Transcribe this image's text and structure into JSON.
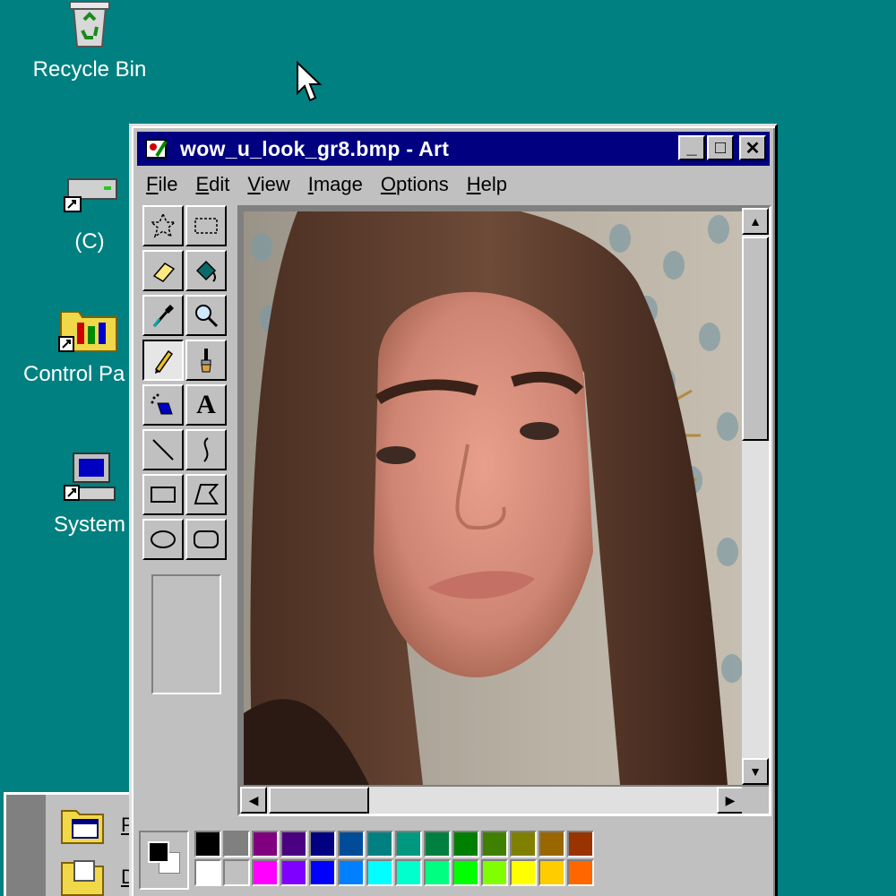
{
  "desktop": {
    "icons": [
      {
        "label": "Recycle Bin"
      },
      {
        "label": "(C)"
      },
      {
        "label": "Control Pa"
      },
      {
        "label": "System"
      }
    ]
  },
  "start_menu": {
    "items": [
      {
        "label": "P"
      },
      {
        "label": "D"
      }
    ]
  },
  "window": {
    "title": "wow_u_look_gr8.bmp - Art",
    "buttons": {
      "minimize": "_",
      "maximize": "□",
      "close": "✕"
    },
    "menus": [
      "File",
      "Edit",
      "View",
      "Image",
      "Options",
      "Help"
    ],
    "tools": [
      "free-form-select-icon",
      "select-icon",
      "eraser-icon",
      "fill-icon",
      "pick-color-icon",
      "magnifier-icon",
      "pencil-icon",
      "brush-icon",
      "airbrush-icon",
      "text-icon",
      "line-icon",
      "curve-icon",
      "rectangle-icon",
      "polygon-icon",
      "ellipse-icon",
      "rounded-rectangle-icon"
    ],
    "active_tool": "pencil-icon",
    "text_tool_glyph": "A",
    "colors": {
      "foreground": "#000000",
      "background": "#ffffff",
      "palette_top": [
        "#000000",
        "#808080",
        "#800080",
        "#4b0082",
        "#000080",
        "#004c99",
        "#008080",
        "#009980",
        "#008040",
        "#008000",
        "#408000",
        "#808000",
        "#996600",
        "#993300"
      ],
      "palette_bottom": [
        "#ffffff",
        "#c0c0c0",
        "#ff00ff",
        "#8000ff",
        "#0000ff",
        "#0080ff",
        "#00ffff",
        "#00ffcc",
        "#00ff80",
        "#00ff00",
        "#80ff00",
        "#ffff00",
        "#ffcc00",
        "#ff6600"
      ]
    }
  }
}
